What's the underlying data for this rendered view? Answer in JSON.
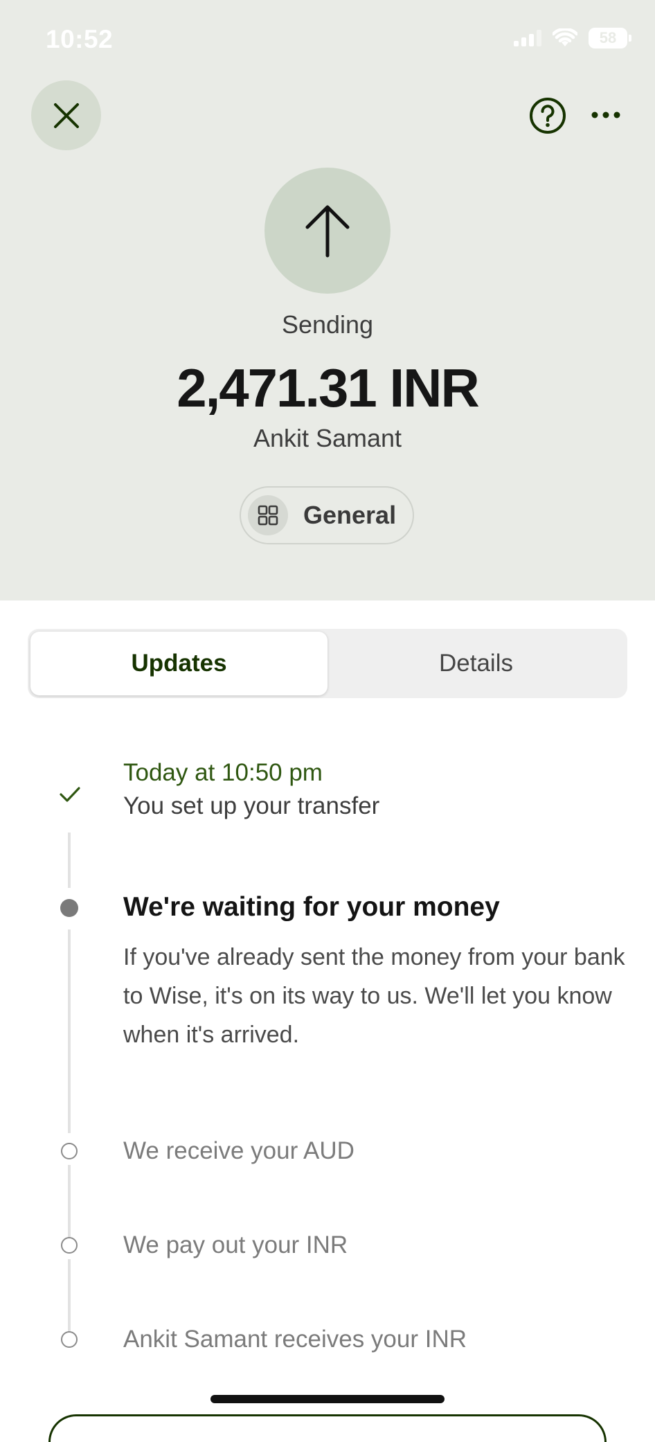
{
  "status_bar": {
    "time": "10:52",
    "battery": "58"
  },
  "header": {
    "close_icon": "close-icon",
    "help_icon": "help-icon",
    "more_icon": "more-icon"
  },
  "transfer": {
    "direction_icon": "arrow-up-icon",
    "status_label": "Sending",
    "amount": "2,471.31 INR",
    "recipient": "Ankit Samant",
    "category": {
      "icon": "grid-icon",
      "label": "General"
    }
  },
  "tabs": [
    {
      "label": "Updates",
      "active": true
    },
    {
      "label": "Details",
      "active": false
    }
  ],
  "timeline": [
    {
      "state": "done",
      "when": "Today at 10:50 pm",
      "text": "You set up your transfer"
    },
    {
      "state": "current",
      "title": "We're waiting for your money",
      "body": "If you've already sent the money from your bank to Wise, it's on its way to us. We'll let you know when it's arrived."
    },
    {
      "state": "pending",
      "text": "We receive your AUD"
    },
    {
      "state": "pending",
      "text": "We pay out your INR"
    },
    {
      "state": "pending",
      "text": "Ankit Samant receives your INR"
    }
  ],
  "colors": {
    "header_bg": "#e9ebe6",
    "accent_green": "#163300",
    "success_green": "#2f5711",
    "icon_circle": "#ccd6c8"
  }
}
